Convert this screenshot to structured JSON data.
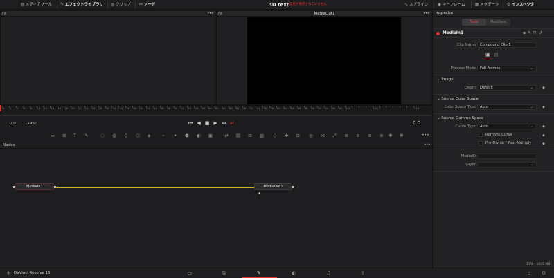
{
  "top_bar": {
    "media_pool": "メディアプール",
    "effects_library": "エフェクトライブラリ",
    "clips": "クリップ",
    "nodes": "ノード",
    "title": "3D text",
    "status": "変更が保存されていません",
    "spline": "スプライン",
    "keyframes": "キーフレーム",
    "metadata": "メタデータ",
    "inspector": "インスペクタ"
  },
  "viewer_left": {
    "zoom": "Fit"
  },
  "viewer_right": {
    "zoom": "Fit",
    "title": "MediaOut1"
  },
  "ruler_ticks": [
    "0",
    "2",
    "4",
    "6",
    "8",
    "10",
    "12",
    "14",
    "16",
    "18",
    "20",
    "22",
    "24",
    "26",
    "28",
    "30",
    "32",
    "34",
    "36",
    "38",
    "40",
    "42",
    "44",
    "46",
    "48",
    "50",
    "52",
    "54",
    "56",
    "58",
    "60",
    "62",
    "64",
    "66",
    "68",
    "70",
    "72",
    "74",
    "76",
    "78",
    "80",
    "82",
    "84",
    "86",
    "88",
    "90",
    "92",
    "94",
    "96",
    "98",
    "100",
    "",
    "",
    "",
    "110",
    "",
    "",
    "",
    "",
    "",
    "115"
  ],
  "transport": {
    "start": "0.0",
    "end": "119.0",
    "current": "0.0"
  },
  "nodes_panel": {
    "title": "Nodes",
    "media_in": "MediaIn1",
    "media_out": "MediaOut1"
  },
  "inspector": {
    "title": "Inspector",
    "tab_tools": "Tools",
    "tab_modifiers": "Modifiers",
    "node_name": "MediaIn1",
    "clip_name_label": "Clip Name",
    "clip_name_value": "Compound Clip 1",
    "process_mode_label": "Process Mode",
    "process_mode_value": "Full Frames",
    "image_section": "Image",
    "depth_label": "Depth",
    "depth_value": "Default",
    "source_color_section": "Source Color Space",
    "color_space_type_label": "Color Space Type",
    "color_space_type_value": "Auto",
    "source_gamma_section": "Source Gamma Space",
    "curve_type_label": "Curve Type",
    "curve_type_value": "Auto",
    "remove_curve": "Remove Curve",
    "pre_divide": "Pre-Divide / Post-Multiply",
    "media_id_label": "MediaID",
    "media_id_value": "",
    "layer_label": "Layer",
    "layer_value": ""
  },
  "status_bar": {
    "app_name": "DaVinci Resolve 15",
    "memory": "13% - 1045 MB"
  },
  "colors": {
    "accent_red": "#e0322e",
    "connection": "#d8b020",
    "status_red": "#e33"
  }
}
